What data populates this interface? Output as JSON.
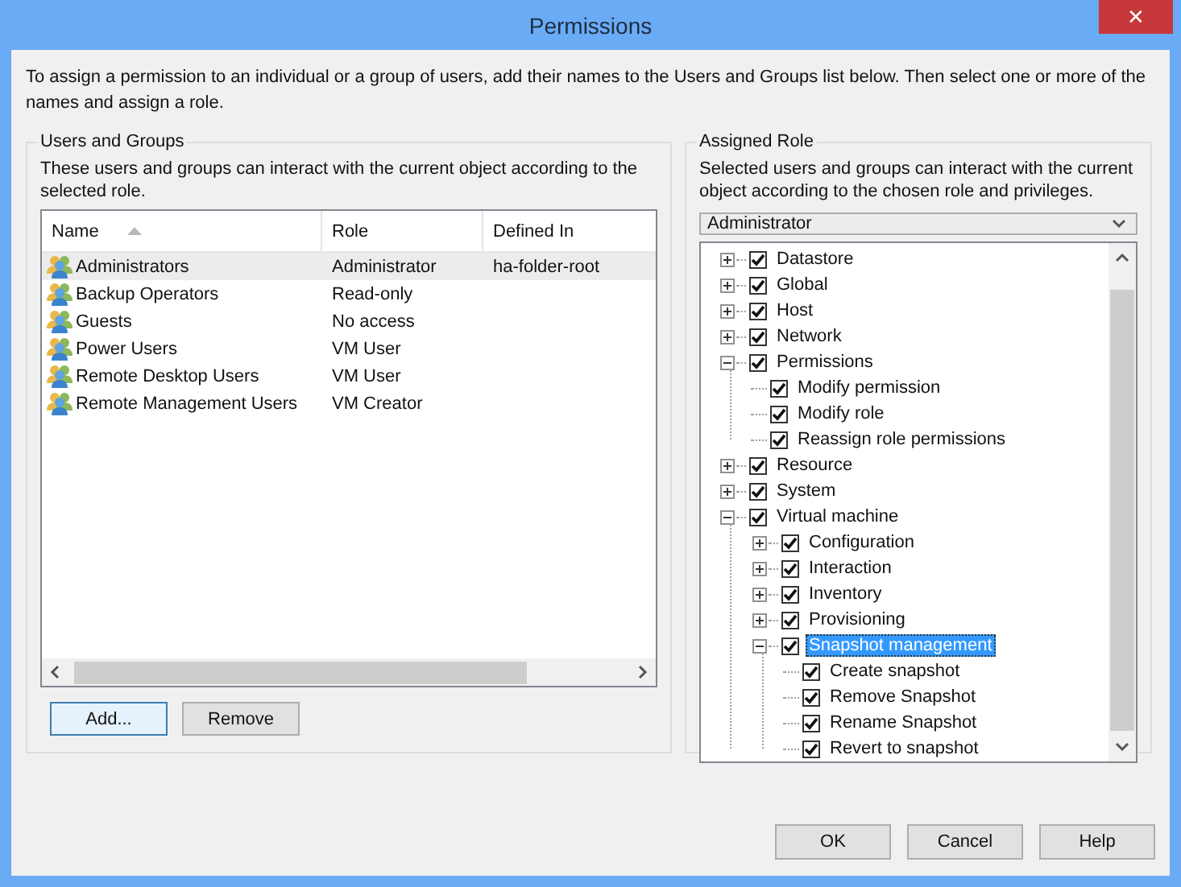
{
  "window": {
    "title": "Permissions",
    "close": "✕"
  },
  "intro": "To assign a permission to an individual or a group of users, add their names to the Users and Groups list below. Then select one or more of the names and assign a role.",
  "users_and_groups": {
    "title": "Users and Groups",
    "description": "These users and groups can interact with the current object according to the selected role.",
    "columns": [
      "Name",
      "Role",
      "Defined In"
    ],
    "rows": [
      {
        "name": "Administrators",
        "role": "Administrator",
        "defined_in": "ha-folder-root",
        "selected": true
      },
      {
        "name": "Backup Operators",
        "role": "Read-only",
        "selected": false
      },
      {
        "name": "Guests",
        "role": "No access",
        "selected": false
      },
      {
        "name": "Power Users",
        "role": "VM User",
        "selected": false
      },
      {
        "name": "Remote Desktop Users",
        "role": "VM User",
        "selected": false
      },
      {
        "name": "Remote Management Users",
        "role": "VM Creator",
        "selected": false
      }
    ],
    "buttons": [
      {
        "label": "Add...",
        "focused": true
      },
      {
        "label": "Remove",
        "focused": false
      }
    ]
  },
  "assigned_role": {
    "title": "Assigned Role",
    "description": "Selected users and groups can interact with the current object according to the chosen role and privileges.",
    "role": "Administrator",
    "tree": [
      {
        "label": "Datastore",
        "checked": true,
        "expanded": false,
        "selected": false
      },
      {
        "label": "Global",
        "checked": true,
        "expanded": false,
        "selected": false
      },
      {
        "label": "Host",
        "checked": true,
        "expanded": false,
        "selected": false
      },
      {
        "label": "Network",
        "checked": true,
        "expanded": false,
        "selected": false
      },
      {
        "label": "Permissions",
        "checked": true,
        "expanded": true,
        "selected": false,
        "children": [
          {
            "label": "Modify permission",
            "checked": true,
            "selected": false
          },
          {
            "label": "Modify role",
            "checked": true,
            "selected": false
          },
          {
            "label": "Reassign role permissions",
            "checked": true,
            "selected": false
          }
        ]
      },
      {
        "label": "Resource",
        "checked": true,
        "expanded": false,
        "selected": false
      },
      {
        "label": "System",
        "checked": true,
        "expanded": false,
        "selected": false
      },
      {
        "label": "Virtual machine",
        "checked": true,
        "expanded": true,
        "selected": false,
        "children": [
          {
            "label": "Configuration",
            "checked": true,
            "expanded": false,
            "selected": false
          },
          {
            "label": "Interaction",
            "checked": true,
            "expanded": false,
            "selected": false
          },
          {
            "label": "Inventory",
            "checked": true,
            "expanded": false,
            "selected": false
          },
          {
            "label": "Provisioning",
            "checked": true,
            "expanded": false,
            "selected": false
          },
          {
            "label": "Snapshot management",
            "checked": true,
            "expanded": true,
            "selected": true,
            "children": [
              {
                "label": "Create snapshot",
                "checked": true,
                "selected": false
              },
              {
                "label": "Remove Snapshot",
                "checked": true,
                "selected": false
              },
              {
                "label": "Rename Snapshot",
                "checked": true,
                "selected": false
              },
              {
                "label": "Revert to snapshot",
                "checked": true,
                "selected": false
              }
            ]
          }
        ]
      }
    ]
  },
  "footer_buttons": [
    "OK",
    "Cancel",
    "Help"
  ]
}
